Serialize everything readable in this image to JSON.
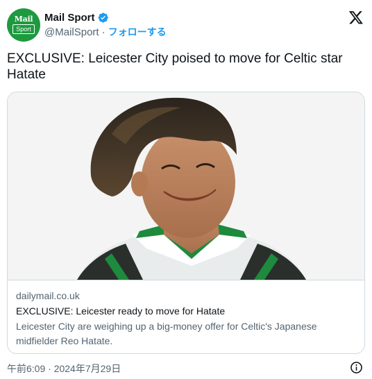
{
  "account": {
    "display_name": "Mail Sport",
    "handle": "@MailSport",
    "separator": "·",
    "follow_label": "フォローする",
    "avatar_text_top": "Mail",
    "avatar_text_bottom": "Sport"
  },
  "tweet": {
    "text": "EXCLUSIVE: Leicester City poised to move for Celtic star Hatate"
  },
  "card": {
    "domain": "dailymail.co.uk",
    "title": "EXCLUSIVE: Leicester ready to move for Hatate",
    "description": "Leicester City are weighing up a big-money offer for Celtic's Japanese midfielder Reo Hatate."
  },
  "footer": {
    "timestamp": "午前6:09 · 2024年7月29日"
  },
  "icons": {
    "verified": "verified-badge-icon",
    "brand": "x-logo-icon",
    "info": "info-icon"
  },
  "colors": {
    "brand_green": "#1d9a3f",
    "link_blue": "#1d9bf0",
    "secondary_text": "#536471",
    "border": "#cfd9de"
  }
}
